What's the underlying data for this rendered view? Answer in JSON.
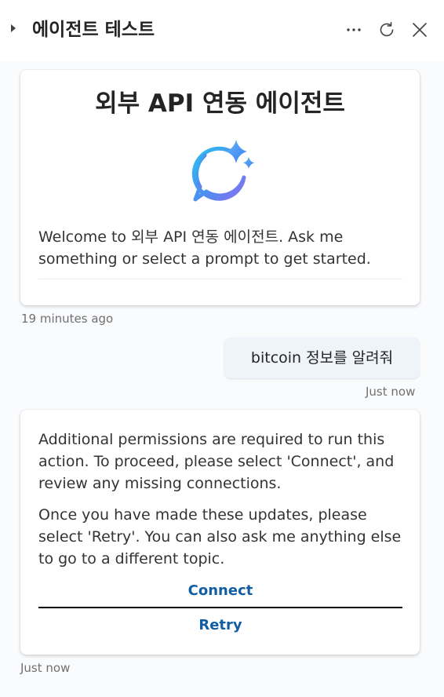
{
  "header": {
    "title": "에이전트 테스트",
    "icons": {
      "collapse": "caret-right-icon",
      "more": "more-horizontal-icon",
      "refresh": "refresh-icon",
      "close": "close-icon"
    }
  },
  "welcome": {
    "title": "외부 API 연동 에이전트",
    "icon": "copilot-chat-sparkle-icon",
    "message": "Welcome to 외부 API 연동 에이전트. Ask me something or select a prompt to get started.",
    "timestamp": "19 minutes ago"
  },
  "user_message": {
    "text": "bitcoin 정보를 알려줘",
    "timestamp": "Just now"
  },
  "permission_message": {
    "paragraph1": "Additional permissions are required to run this action. To proceed, please select 'Connect', and review any missing connections.",
    "paragraph2": "Once you have made these updates, please select 'Retry'. You can also ask me anything else to go to a different topic.",
    "connect_label": "Connect",
    "retry_label": "Retry",
    "timestamp": "Just now"
  },
  "colors": {
    "accent": "#115ea3",
    "background": "#fafbfd",
    "user_bubble": "#eef4fa"
  }
}
